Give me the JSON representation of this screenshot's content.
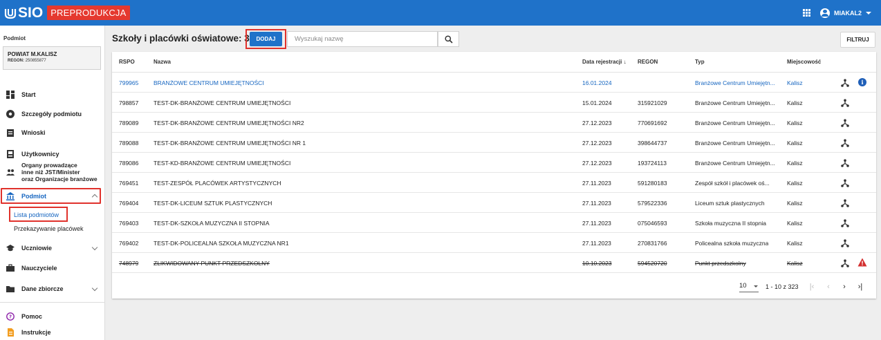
{
  "header": {
    "logo_text": "SIO",
    "env_badge": "PREPRODUKCJA",
    "user_name": "MIAKAL2",
    "brand_color": "#1f72c9",
    "badge_color": "#e5392f"
  },
  "sidebar": {
    "section_label": "Podmiot",
    "entity": {
      "name": "POWIAT M.KALISZ",
      "regon_label": "REGON:",
      "regon_value": "250855877"
    },
    "items": [
      {
        "label": "Start",
        "icon": "dashboard-icon"
      },
      {
        "label": "Szczegóły podmiotu",
        "icon": "info-circle-icon"
      },
      {
        "label": "Wnioski",
        "icon": "assignment-icon"
      },
      {
        "label": "Użytkownicy",
        "icon": "badge-icon"
      },
      {
        "label_lines": [
          "Organy prowadzące",
          "inne niż JST/Minister",
          "oraz Organizacje branżowe"
        ],
        "icon": "people-icon"
      },
      {
        "label": "Podmiot",
        "icon": "bank-icon",
        "expanded": true
      },
      {
        "label": "Uczniowie",
        "icon": "school-icon"
      },
      {
        "label": "Nauczyciele",
        "icon": "briefcase-icon"
      },
      {
        "label": "Dane zbiorcze",
        "icon": "folder-icon"
      },
      {
        "label": "Pomoc",
        "icon": "help-icon"
      },
      {
        "label": "Instrukcje",
        "icon": "document-icon"
      }
    ],
    "sub_items": [
      {
        "label": "Lista podmiotów",
        "active": true
      },
      {
        "label": "Przekazywanie placówek",
        "active": false
      }
    ]
  },
  "main": {
    "title": "Szkoły i placówki oświatowe: 323",
    "add_label": "DODAJ",
    "search_placeholder": "Wyszukaj nazwę",
    "filter_label": "FILTRUJ",
    "columns": [
      "RSPO",
      "Nazwa",
      "Data rejestracji",
      "REGON",
      "Typ",
      "Miejscowość"
    ],
    "rows": [
      {
        "rspo": "799965",
        "name": "BRANŻOWE CENTRUM UMIEJĘTNOŚCI",
        "date": "16.01.2024",
        "regon": "",
        "type": "Branżowe Centrum Umiejętn...",
        "city": "Kalisz",
        "style": "link",
        "extra": "info"
      },
      {
        "rspo": "798857",
        "name": "TEST-DK-BRANŻOWE CENTRUM UMIEJĘTNOŚCI",
        "date": "15.01.2024",
        "regon": "315921029",
        "type": "Branżowe Centrum Umiejętn...",
        "city": "Kalisz",
        "style": "",
        "extra": ""
      },
      {
        "rspo": "789089",
        "name": "TEST-DK-BRANŻOWE CENTRUM UMIEJĘTNOŚCI NR2",
        "date": "27.12.2023",
        "regon": "770691692",
        "type": "Branżowe Centrum Umiejętn...",
        "city": "Kalisz",
        "style": "",
        "extra": ""
      },
      {
        "rspo": "789088",
        "name": "TEST-DK-BRANŻOWE CENTRUM UMIEJĘTNOŚCI NR 1",
        "date": "27.12.2023",
        "regon": "398644737",
        "type": "Branżowe Centrum Umiejętn...",
        "city": "Kalisz",
        "style": "",
        "extra": ""
      },
      {
        "rspo": "789086",
        "name": "TEST-KD-BRANŻOWE CENTRUM UMIEJĘTNOŚCI",
        "date": "27.12.2023",
        "regon": "193724113",
        "type": "Branżowe Centrum Umiejętn...",
        "city": "Kalisz",
        "style": "",
        "extra": ""
      },
      {
        "rspo": "769451",
        "name": "TEST-ZESPÓŁ PLACÓWEK ARTYSTYCZNYCH",
        "date": "27.11.2023",
        "regon": "591280183",
        "type": "Zespół szkół i placówek oś...",
        "city": "Kalisz",
        "style": "",
        "extra": ""
      },
      {
        "rspo": "769404",
        "name": "TEST-DK-LICEUM SZTUK PLASTYCZNYCH",
        "date": "27.11.2023",
        "regon": "579522336",
        "type": "Liceum sztuk plastycznych",
        "city": "Kalisz",
        "style": "",
        "extra": ""
      },
      {
        "rspo": "769403",
        "name": "TEST-DK-SZKOŁA MUZYCZNA II STOPNIA",
        "date": "27.11.2023",
        "regon": "075046593",
        "type": "Szkoła muzyczna II stopnia",
        "city": "Kalisz",
        "style": "",
        "extra": ""
      },
      {
        "rspo": "769402",
        "name": "TEST-DK-POLICEALNA SZKOŁA MUZYCZNA NR1",
        "date": "27.11.2023",
        "regon": "270831766",
        "type": "Policealna szkoła muzyczna",
        "city": "Kalisz",
        "style": "",
        "extra": ""
      },
      {
        "rspo": "748979",
        "name": "ZLIKWIDOWANY PUNKT PRZEDSZKOLNY",
        "date": "10.10.2023",
        "regon": "594520720",
        "type": "Punkt przedszkolny",
        "city": "Kalisz",
        "style": "struck",
        "extra": "warning"
      }
    ],
    "pagination": {
      "per_page": "10",
      "range": "1 - 10 z 323"
    },
    "highlight_color": "#e0312b",
    "warning_color": "#d32f2f"
  }
}
